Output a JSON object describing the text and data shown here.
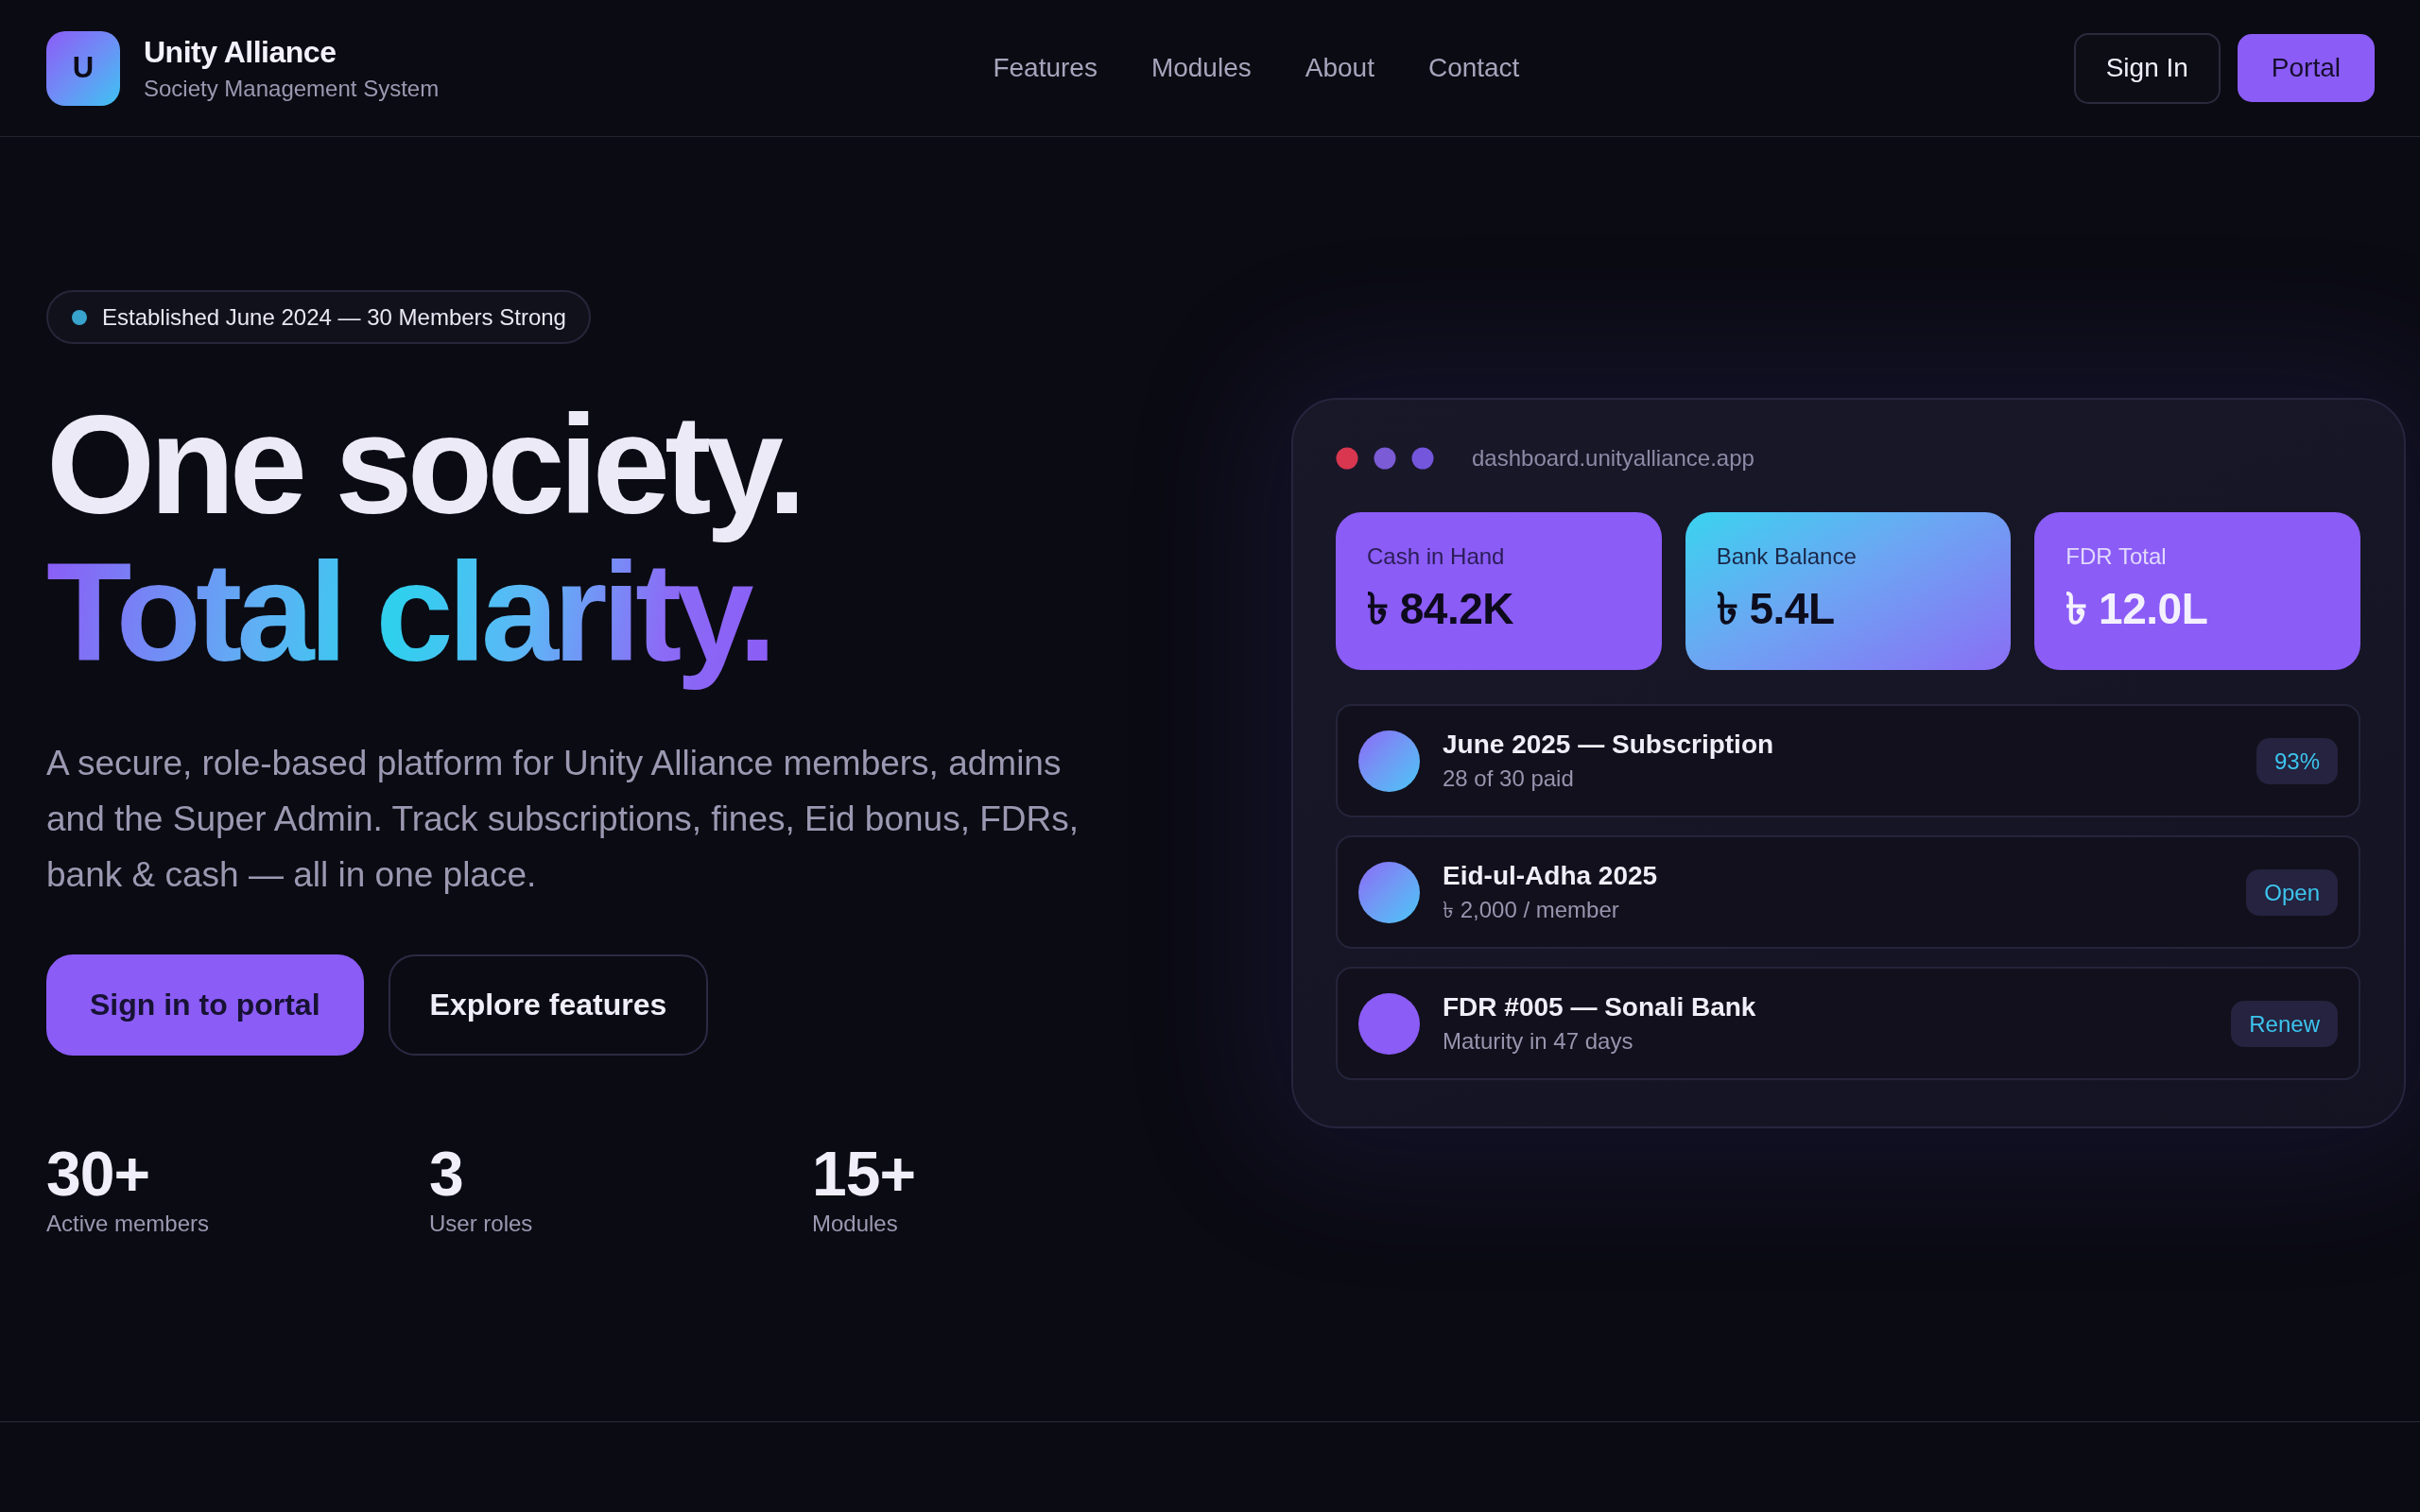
{
  "brand": {
    "logo_letter": "U",
    "name": "Unity Alliance",
    "tagline": "Society Management System"
  },
  "nav": [
    "Features",
    "Modules",
    "About",
    "Contact"
  ],
  "header_buttons": [
    {
      "label": "Sign In",
      "kind": "outline"
    },
    {
      "label": "Portal",
      "kind": "primary"
    }
  ],
  "hero": {
    "badge": "Established June 2024 — 30 Members Strong",
    "headline": "One society.",
    "headline_accent": "Total clarity.",
    "description": "A secure, role-based platform for Unity Alliance members, admins and the Super Admin. Track subscriptions, fines, Eid bonus, FDRs, bank & cash — all in one place.",
    "buttons": [
      {
        "label": "Sign in to portal",
        "kind": "primary"
      },
      {
        "label": "Explore features",
        "kind": "outline"
      }
    ],
    "stats": [
      {
        "value": "30+",
        "label": "Active members"
      },
      {
        "value": "3",
        "label": "User roles"
      },
      {
        "value": "15+",
        "label": "Modules"
      }
    ]
  },
  "dashboard": {
    "url": "dashboard.unityalliance.app",
    "cards": [
      {
        "label": "Cash in Hand",
        "value": "৳ 84.2K",
        "kind": "solid"
      },
      {
        "label": "Bank Balance",
        "value": "৳ 5.4L",
        "kind": "gradient"
      },
      {
        "label": "FDR Total",
        "value": "৳ 12.0L",
        "kind": "inverse"
      }
    ],
    "items": [
      {
        "title": "June 2025 — Subscription",
        "detail": "28 of 30 paid",
        "badge": "93%",
        "kind": "gradient"
      },
      {
        "title": "Eid-ul-Adha 2025",
        "detail": "৳ 2,000 / member",
        "badge": "Open",
        "kind": "gradient"
      },
      {
        "title": "FDR #005 — Sonali Bank",
        "detail": "Maturity in 47 days",
        "badge": "Renew",
        "kind": "solid"
      }
    ]
  }
}
